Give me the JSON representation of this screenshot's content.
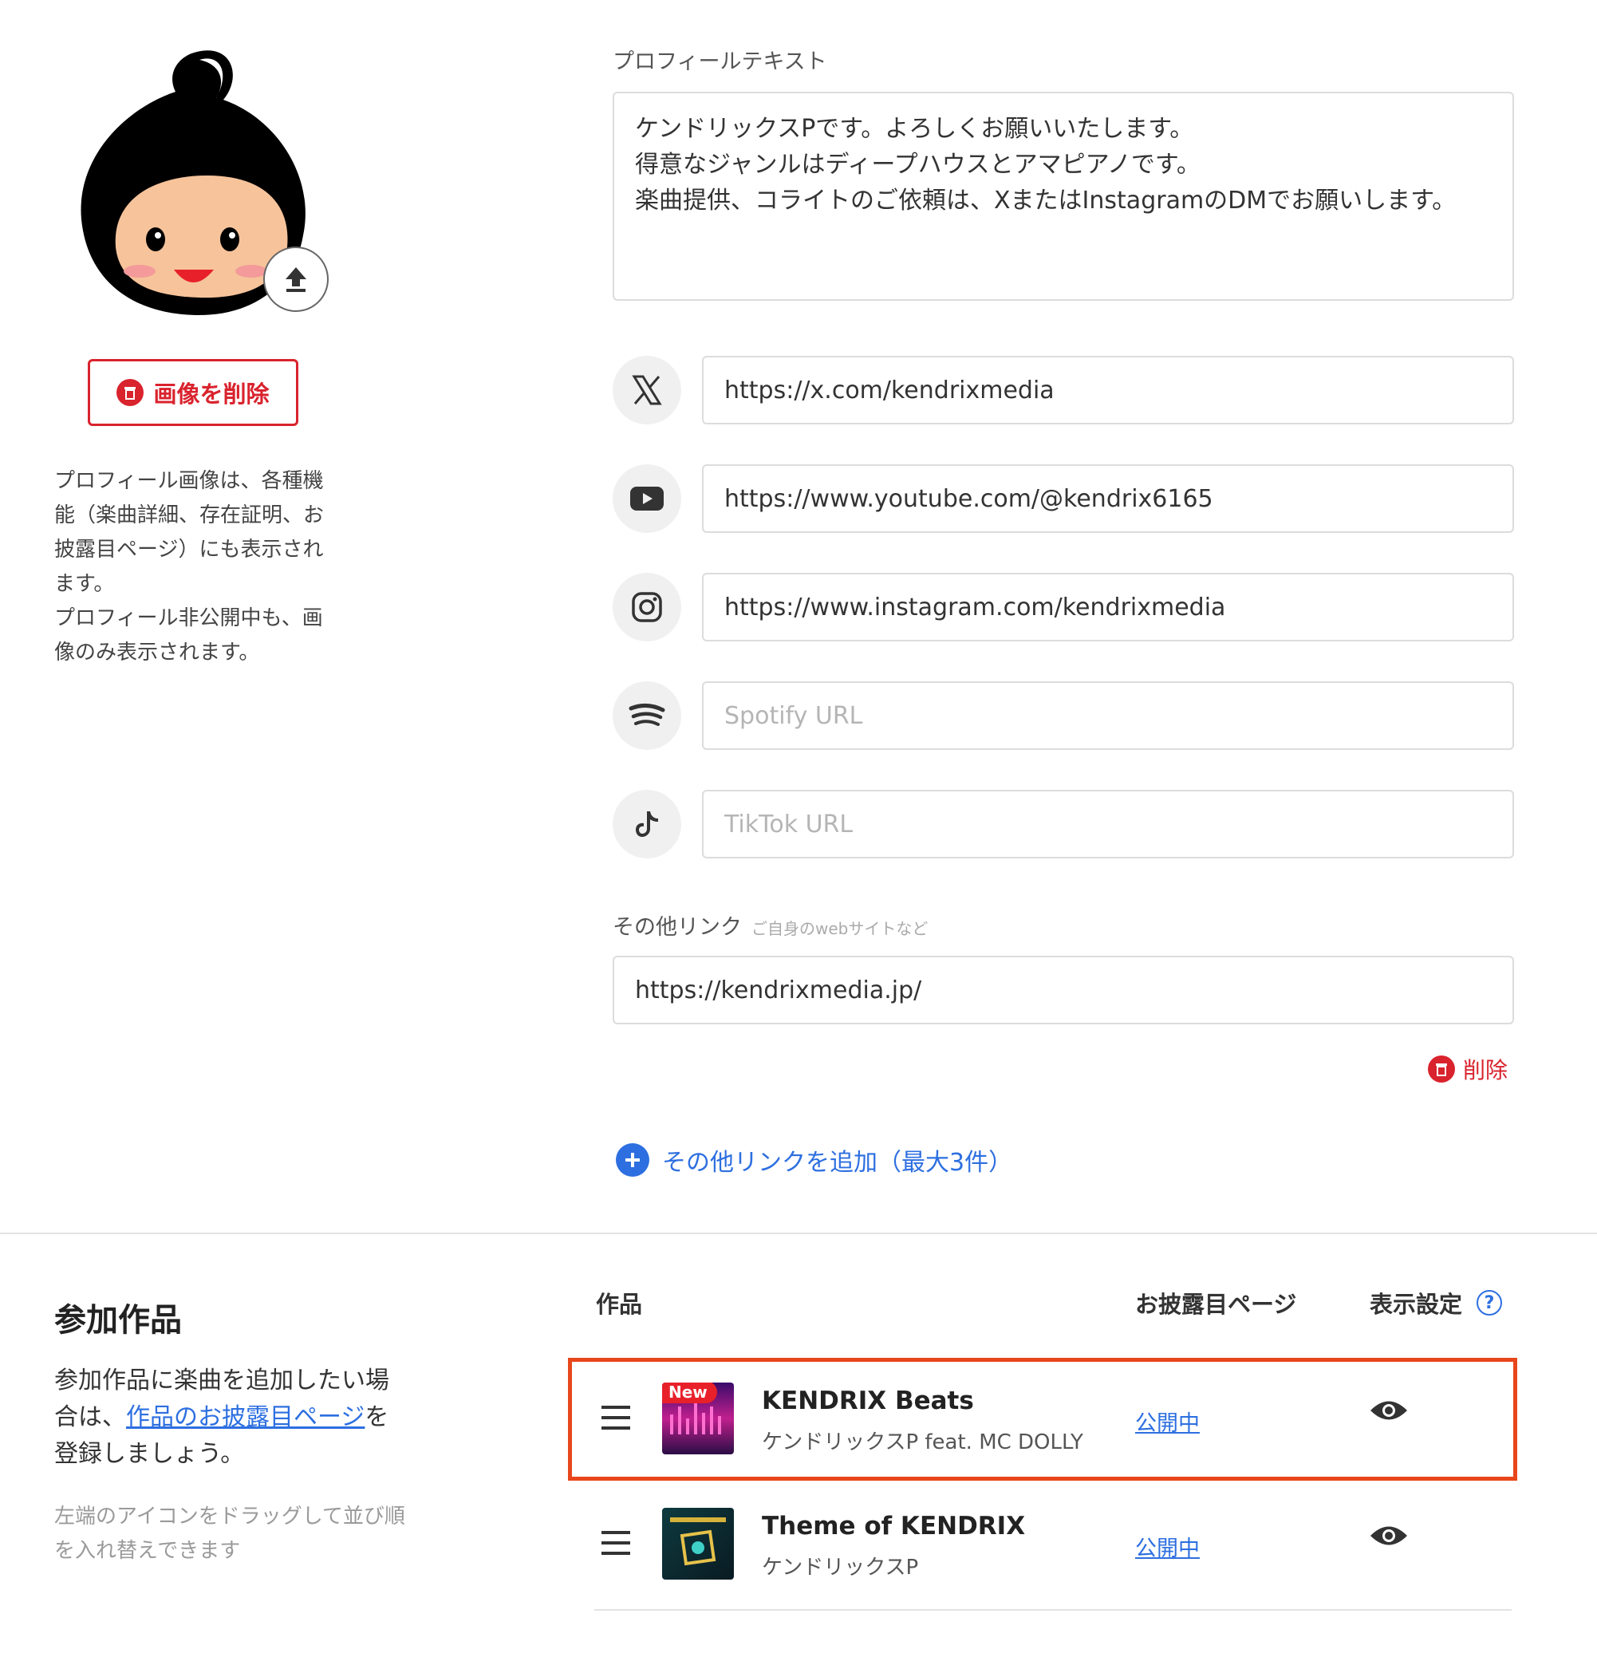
{
  "avatar": {
    "delete_label": "画像を削除"
  },
  "avatar_note": "プロフィール画像は、各種機能（楽曲詳細、存在証明、お披露目ページ）にも表示されます。\nプロフィール非公開中も、画像のみ表示されます。",
  "profile_text": {
    "label": "プロフィールテキスト",
    "value": "ケンドリックスPです。よろしくお願いいたします。\n得意なジャンルはディープハウスとアマピアノです。\n楽曲提供、コライトのご依頼は、XまたはInstagramのDMでお願いします。"
  },
  "sns": [
    {
      "icon": "x-icon",
      "value": "https://x.com/kendrixmedia",
      "placeholder": ""
    },
    {
      "icon": "youtube-icon",
      "value": "https://www.youtube.com/@kendrix6165",
      "placeholder": ""
    },
    {
      "icon": "instagram-icon",
      "value": "https://www.instagram.com/kendrixmedia",
      "placeholder": ""
    },
    {
      "icon": "spotify-icon",
      "value": "",
      "placeholder": "Spotify URL"
    },
    {
      "icon": "tiktok-icon",
      "value": "",
      "placeholder": "TikTok URL"
    }
  ],
  "other_links": {
    "label": "その他リンク",
    "hint": "ご自身のwebサイトなど",
    "value": "https://kendrixmedia.jp/",
    "delete_label": "削除",
    "add_label": "その他リンクを追加（最大3件）"
  },
  "works": {
    "title": "参加作品",
    "desc_before": "参加作品に楽曲を追加したい場合は、",
    "desc_link": "作品のお披露目ページ",
    "desc_after": "を登録しましょう。",
    "hint": "左端のアイコンをドラッグして並び順を入れ替えできます",
    "col_work": "作品",
    "col_page": "お披露目ページ",
    "col_display": "表示設定",
    "items": [
      {
        "title": "KENDRIX Beats",
        "artist": "ケンドリックスP feat. MC DOLLY",
        "status": "公開中",
        "badge": "New"
      },
      {
        "title": "Theme of KENDRIX",
        "artist": "ケンドリックスP",
        "status": "公開中"
      }
    ]
  },
  "colors": {
    "accent_blue": "#2d6fe0",
    "danger_red": "#d9232d",
    "highlight": "#e8461b"
  }
}
